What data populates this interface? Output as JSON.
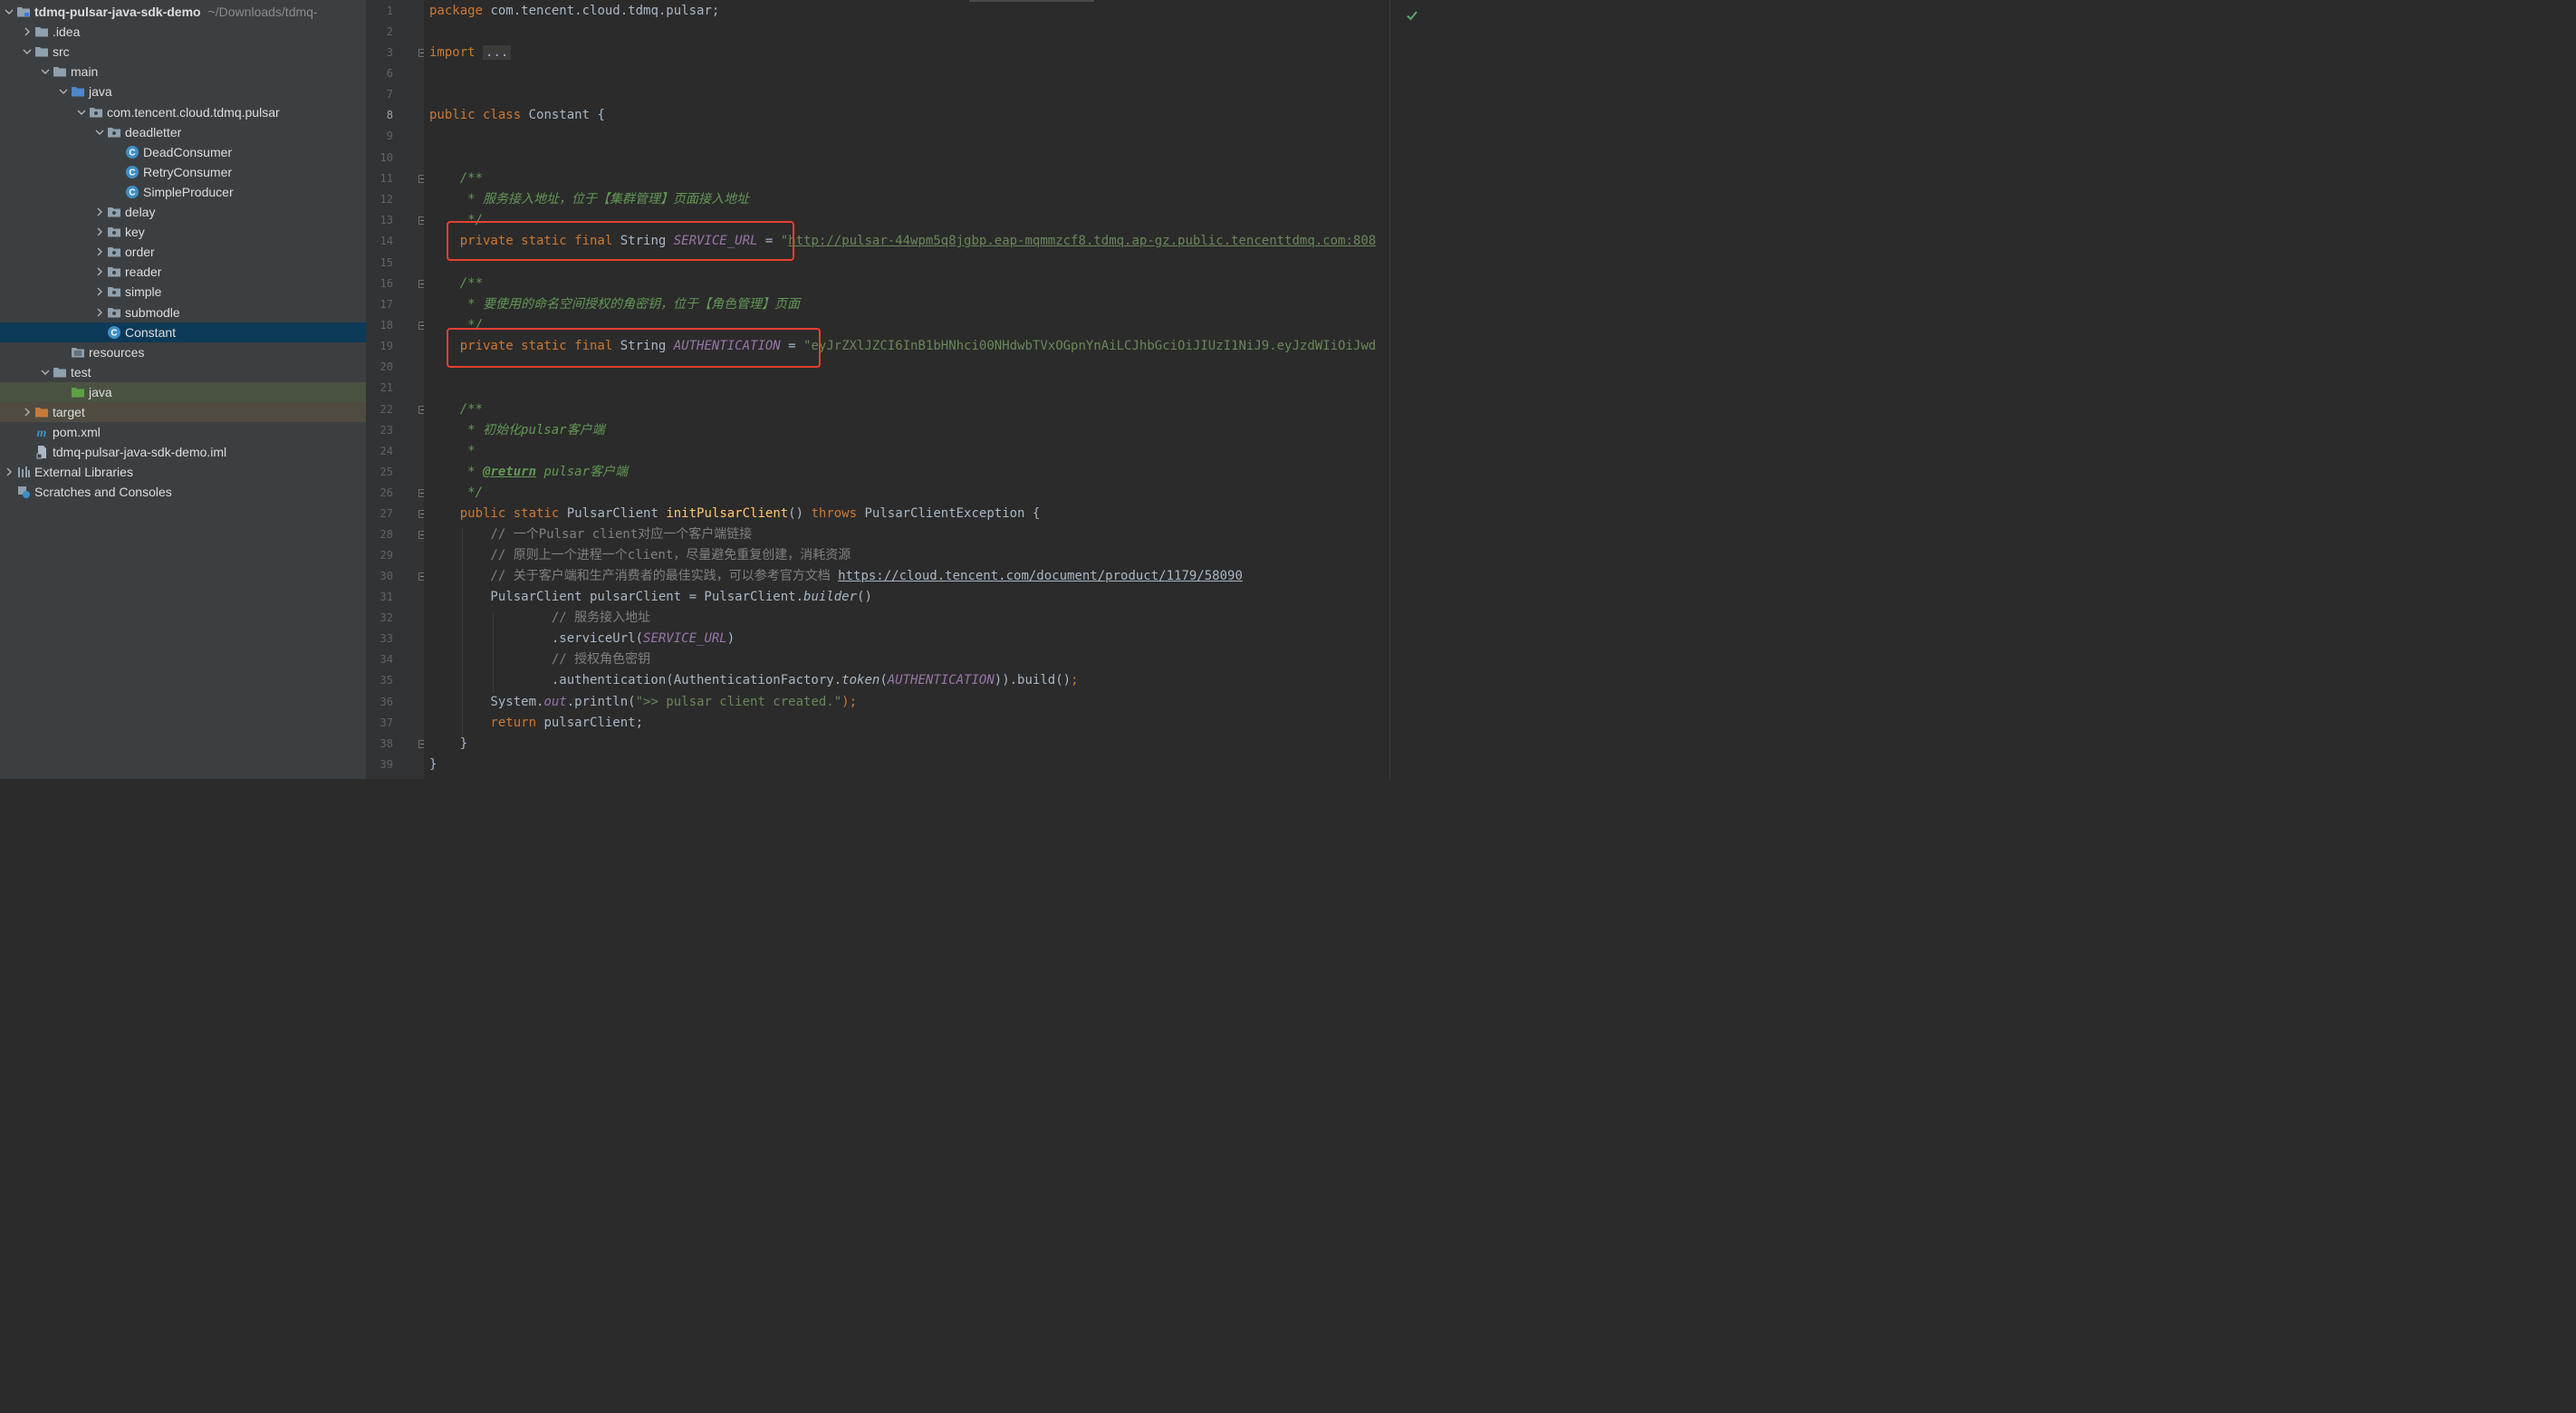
{
  "colors": {
    "tree_bg": "#3c3f41",
    "editor_bg": "#2b2b2b",
    "selected_row": "#0d3a58",
    "keyword": "#cc7832",
    "string": "#6a8759",
    "constant": "#9876aa",
    "highlight_box": "#e8402f"
  },
  "project_tree": [
    {
      "label": "tdmq-pulsar-java-sdk-demo",
      "path": "~/Downloads/tdmq-",
      "icon": "module-folder-icon",
      "depth": 0,
      "expanded": true,
      "bold": true
    },
    {
      "label": ".idea",
      "icon": "folder-icon",
      "depth": 1,
      "expanded": false
    },
    {
      "label": "src",
      "icon": "folder-icon",
      "depth": 1,
      "expanded": true
    },
    {
      "label": "main",
      "icon": "folder-icon",
      "depth": 2,
      "expanded": true
    },
    {
      "label": "java",
      "icon": "source-folder-icon",
      "depth": 3,
      "expanded": true
    },
    {
      "label": "com.tencent.cloud.tdmq.pulsar",
      "icon": "package-icon",
      "depth": 4,
      "expanded": true
    },
    {
      "label": "deadletter",
      "icon": "package-icon",
      "depth": 5,
      "expanded": true
    },
    {
      "label": "DeadConsumer",
      "icon": "java-class-icon",
      "depth": 6
    },
    {
      "label": "RetryConsumer",
      "icon": "java-class-icon",
      "depth": 6
    },
    {
      "label": "SimpleProducer",
      "icon": "java-class-icon",
      "depth": 6
    },
    {
      "label": "delay",
      "icon": "package-icon",
      "depth": 5,
      "expanded": false
    },
    {
      "label": "key",
      "icon": "package-icon",
      "depth": 5,
      "expanded": false
    },
    {
      "label": "order",
      "icon": "package-icon",
      "depth": 5,
      "expanded": false
    },
    {
      "label": "reader",
      "icon": "package-icon",
      "depth": 5,
      "expanded": false
    },
    {
      "label": "simple",
      "icon": "package-icon",
      "depth": 5,
      "expanded": false
    },
    {
      "label": "submodle",
      "icon": "package-icon",
      "depth": 5,
      "expanded": false
    },
    {
      "label": "Constant",
      "icon": "java-class-icon",
      "depth": 5,
      "selected": true
    },
    {
      "label": "resources",
      "icon": "resources-folder-icon",
      "depth": 3
    },
    {
      "label": "test",
      "icon": "folder-icon",
      "depth": 2,
      "expanded": true
    },
    {
      "label": "java",
      "icon": "test-source-folder-icon",
      "depth": 3,
      "highlight": true
    },
    {
      "label": "target",
      "icon": "excluded-folder-icon",
      "depth": 1,
      "expanded": false,
      "target": true
    },
    {
      "label": "pom.xml",
      "icon": "maven-icon",
      "depth": 1
    },
    {
      "label": "tdmq-pulsar-java-sdk-demo.iml",
      "icon": "iml-file-icon",
      "depth": 1
    },
    {
      "label": "External Libraries",
      "icon": "libraries-icon",
      "depth": 0,
      "expanded": false
    },
    {
      "label": "Scratches and Consoles",
      "icon": "scratches-icon",
      "depth": 0
    }
  ],
  "line_numbers": [
    "1",
    "2",
    "3",
    "6",
    "7",
    "8",
    "9",
    "10",
    "11",
    "12",
    "13",
    "14",
    "15",
    "16",
    "17",
    "18",
    "19",
    "20",
    "21",
    "22",
    "23",
    "24",
    "25",
    "26",
    "27",
    "28",
    "29",
    "30",
    "31",
    "32",
    "33",
    "34",
    "35",
    "36",
    "37",
    "38",
    "39"
  ],
  "current_line": "8",
  "code": {
    "l1_kw": "package",
    "l1_rest": " com.tencent.cloud.tdmq.pulsar;",
    "l3_kw": "import",
    "l3_fold": "...",
    "l8_kw": "public class",
    "l8_rest": " Constant {",
    "l11": "    /**",
    "l12": "     * 服务接入地址，位于【集群管理】页面接入地址",
    "l13": "     */",
    "l14_kw": "    private static final",
    "l14_type": " String ",
    "l14_const": "SERVICE_URL",
    "l14_eq": " = ",
    "l14_q": "\"",
    "l14_url": "http://pulsar-44wpm5q8jgbp.eap-mqmmzcf8.tdmq.ap-gz.public.tencenttdmq.com:808",
    "l16": "    /**",
    "l17": "     * 要使用的命名空间授权的角密钥，位于【角色管理】页面",
    "l18": "     */",
    "l19_kw": "    private static final",
    "l19_type": " String ",
    "l19_const": "AUTHENTICATION",
    "l19_eq": " = ",
    "l19_str": "\"eyJrZXlJZCI6InB1bHNhci00NHdwbTVxOGpnYnAiLCJhbGciOiJIUzI1NiJ9.eyJzdWIiOiJwd",
    "l22": "    /**",
    "l23_pre": "     * 初始化",
    "l23_it": "pulsar",
    "l23_post": "客户端",
    "l24": "     *",
    "l25_pre": "     * ",
    "l25_tag": "@return",
    "l25_it": " pulsar",
    "l25_post": "客户端",
    "l26": "     */",
    "l27_kw1": "    public static",
    "l27_type": " PulsarClient ",
    "l27_fn": "initPulsarClient",
    "l27_paren": "() ",
    "l27_kw2": "throws",
    "l27_rest": " PulsarClientException {",
    "l28": "        // 一个Pulsar client对应一个客户端链接",
    "l29": "        // 原则上一个进程一个client，尽量避免重复创建，消耗资源",
    "l30_pre": "        // 关于客户端和生产消费者的最佳实践，可以参考官方文档 ",
    "l30_url": "https://cloud.tencent.com/document/product/1179/58090",
    "l31_pre": "        PulsarClient pulsarClient = PulsarClient.",
    "l31_it": "builder",
    "l31_post": "()",
    "l32": "                // 服务接入地址",
    "l33_pre": "                .serviceUrl(",
    "l33_const": "SERVICE_URL",
    "l33_post": ")",
    "l34": "                // 授权角色密钥",
    "l35_pre": "                .authentication(AuthenticationFactory.",
    "l35_it": "token",
    "l35_open": "(",
    "l35_const": "AUTHENTICATION",
    "l35_post": ")).build()",
    "l35_semi": ";",
    "l36_pre": "        System.",
    "l36_it": "out",
    "l36_mid": ".println(",
    "l36_str": "\">> pulsar client created.\"",
    "l36_post": ");",
    "l37_kw": "        return",
    "l37_rest": " pulsarClient;",
    "l38": "    }",
    "l39": "}"
  }
}
